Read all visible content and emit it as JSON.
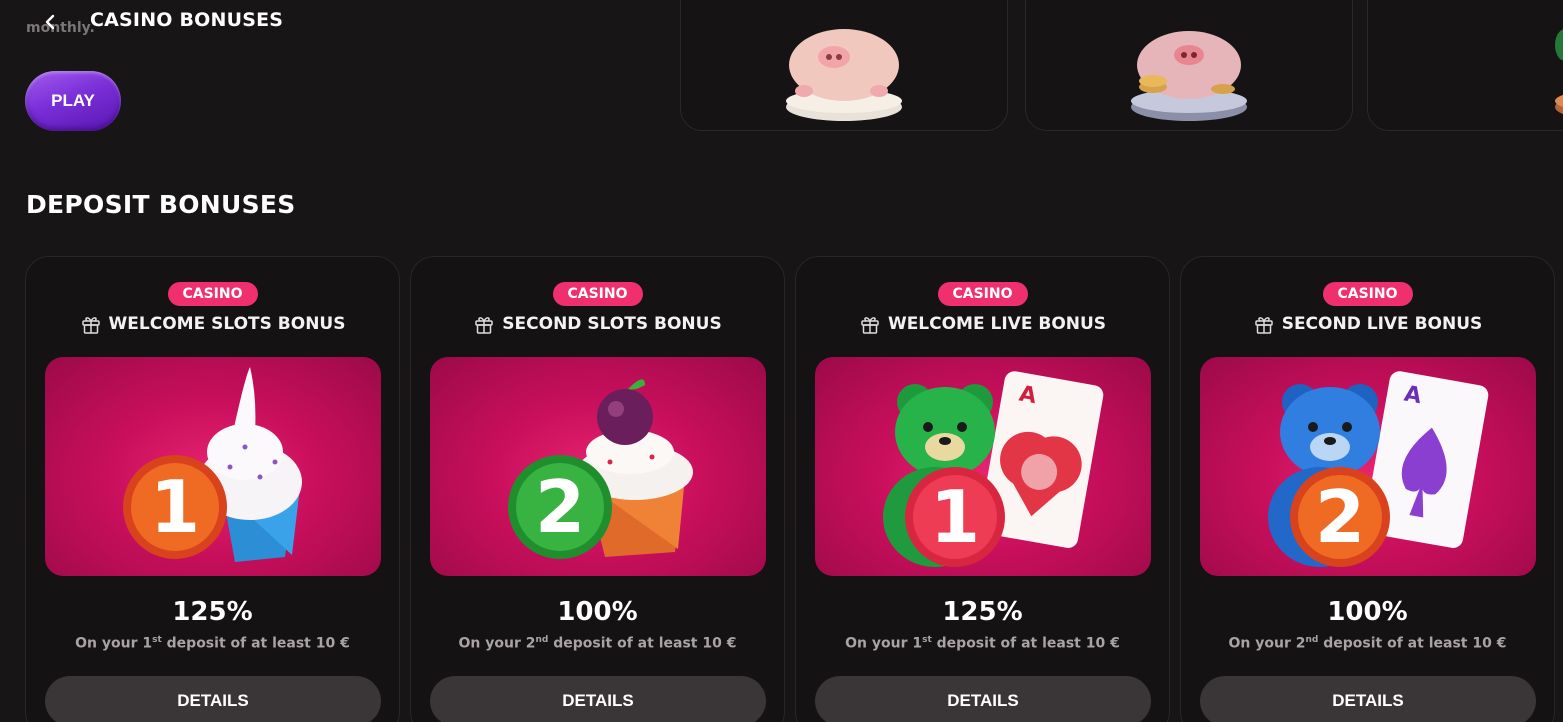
{
  "header": {
    "title": "CASINO BONUSES",
    "partial_text": "monthly."
  },
  "play_label": "PLAY",
  "section_title": "DEPOSIT BONUSES",
  "colors": {
    "background": "#171516",
    "badge": "#f0306e",
    "play_button": "#7a2fd8",
    "details_button": "#3a3536",
    "card_image": "#c80f5c"
  },
  "cards": [
    {
      "badge": "CASINO",
      "name": "WELCOME SLOTS BONUS",
      "percent": "125%",
      "deposit_prefix": "On your 1",
      "deposit_suffix": "st",
      "deposit_rest": " deposit of at least 10 €",
      "details": "DETAILS",
      "image": "cupcake-with-badge-1"
    },
    {
      "badge": "CASINO",
      "name": "SECOND SLOTS BONUS",
      "percent": "100%",
      "deposit_prefix": "On your 2",
      "deposit_suffix": "nd",
      "deposit_rest": " deposit of at least 10 €",
      "details": "DETAILS",
      "image": "plum-cupcake-with-badge-2"
    },
    {
      "badge": "CASINO",
      "name": "WELCOME LIVE BONUS",
      "percent": "125%",
      "deposit_prefix": "On your 1",
      "deposit_suffix": "st",
      "deposit_rest": " deposit of at least 10 €",
      "details": "DETAILS",
      "image": "green-bear-card-badge-1"
    },
    {
      "badge": "CASINO",
      "name": "SECOND LIVE BONUS",
      "percent": "100%",
      "deposit_prefix": "On your 2",
      "deposit_suffix": "nd",
      "deposit_rest": " deposit of at least 10 €",
      "details": "DETAILS",
      "image": "blue-bear-card-badge-2"
    }
  ]
}
